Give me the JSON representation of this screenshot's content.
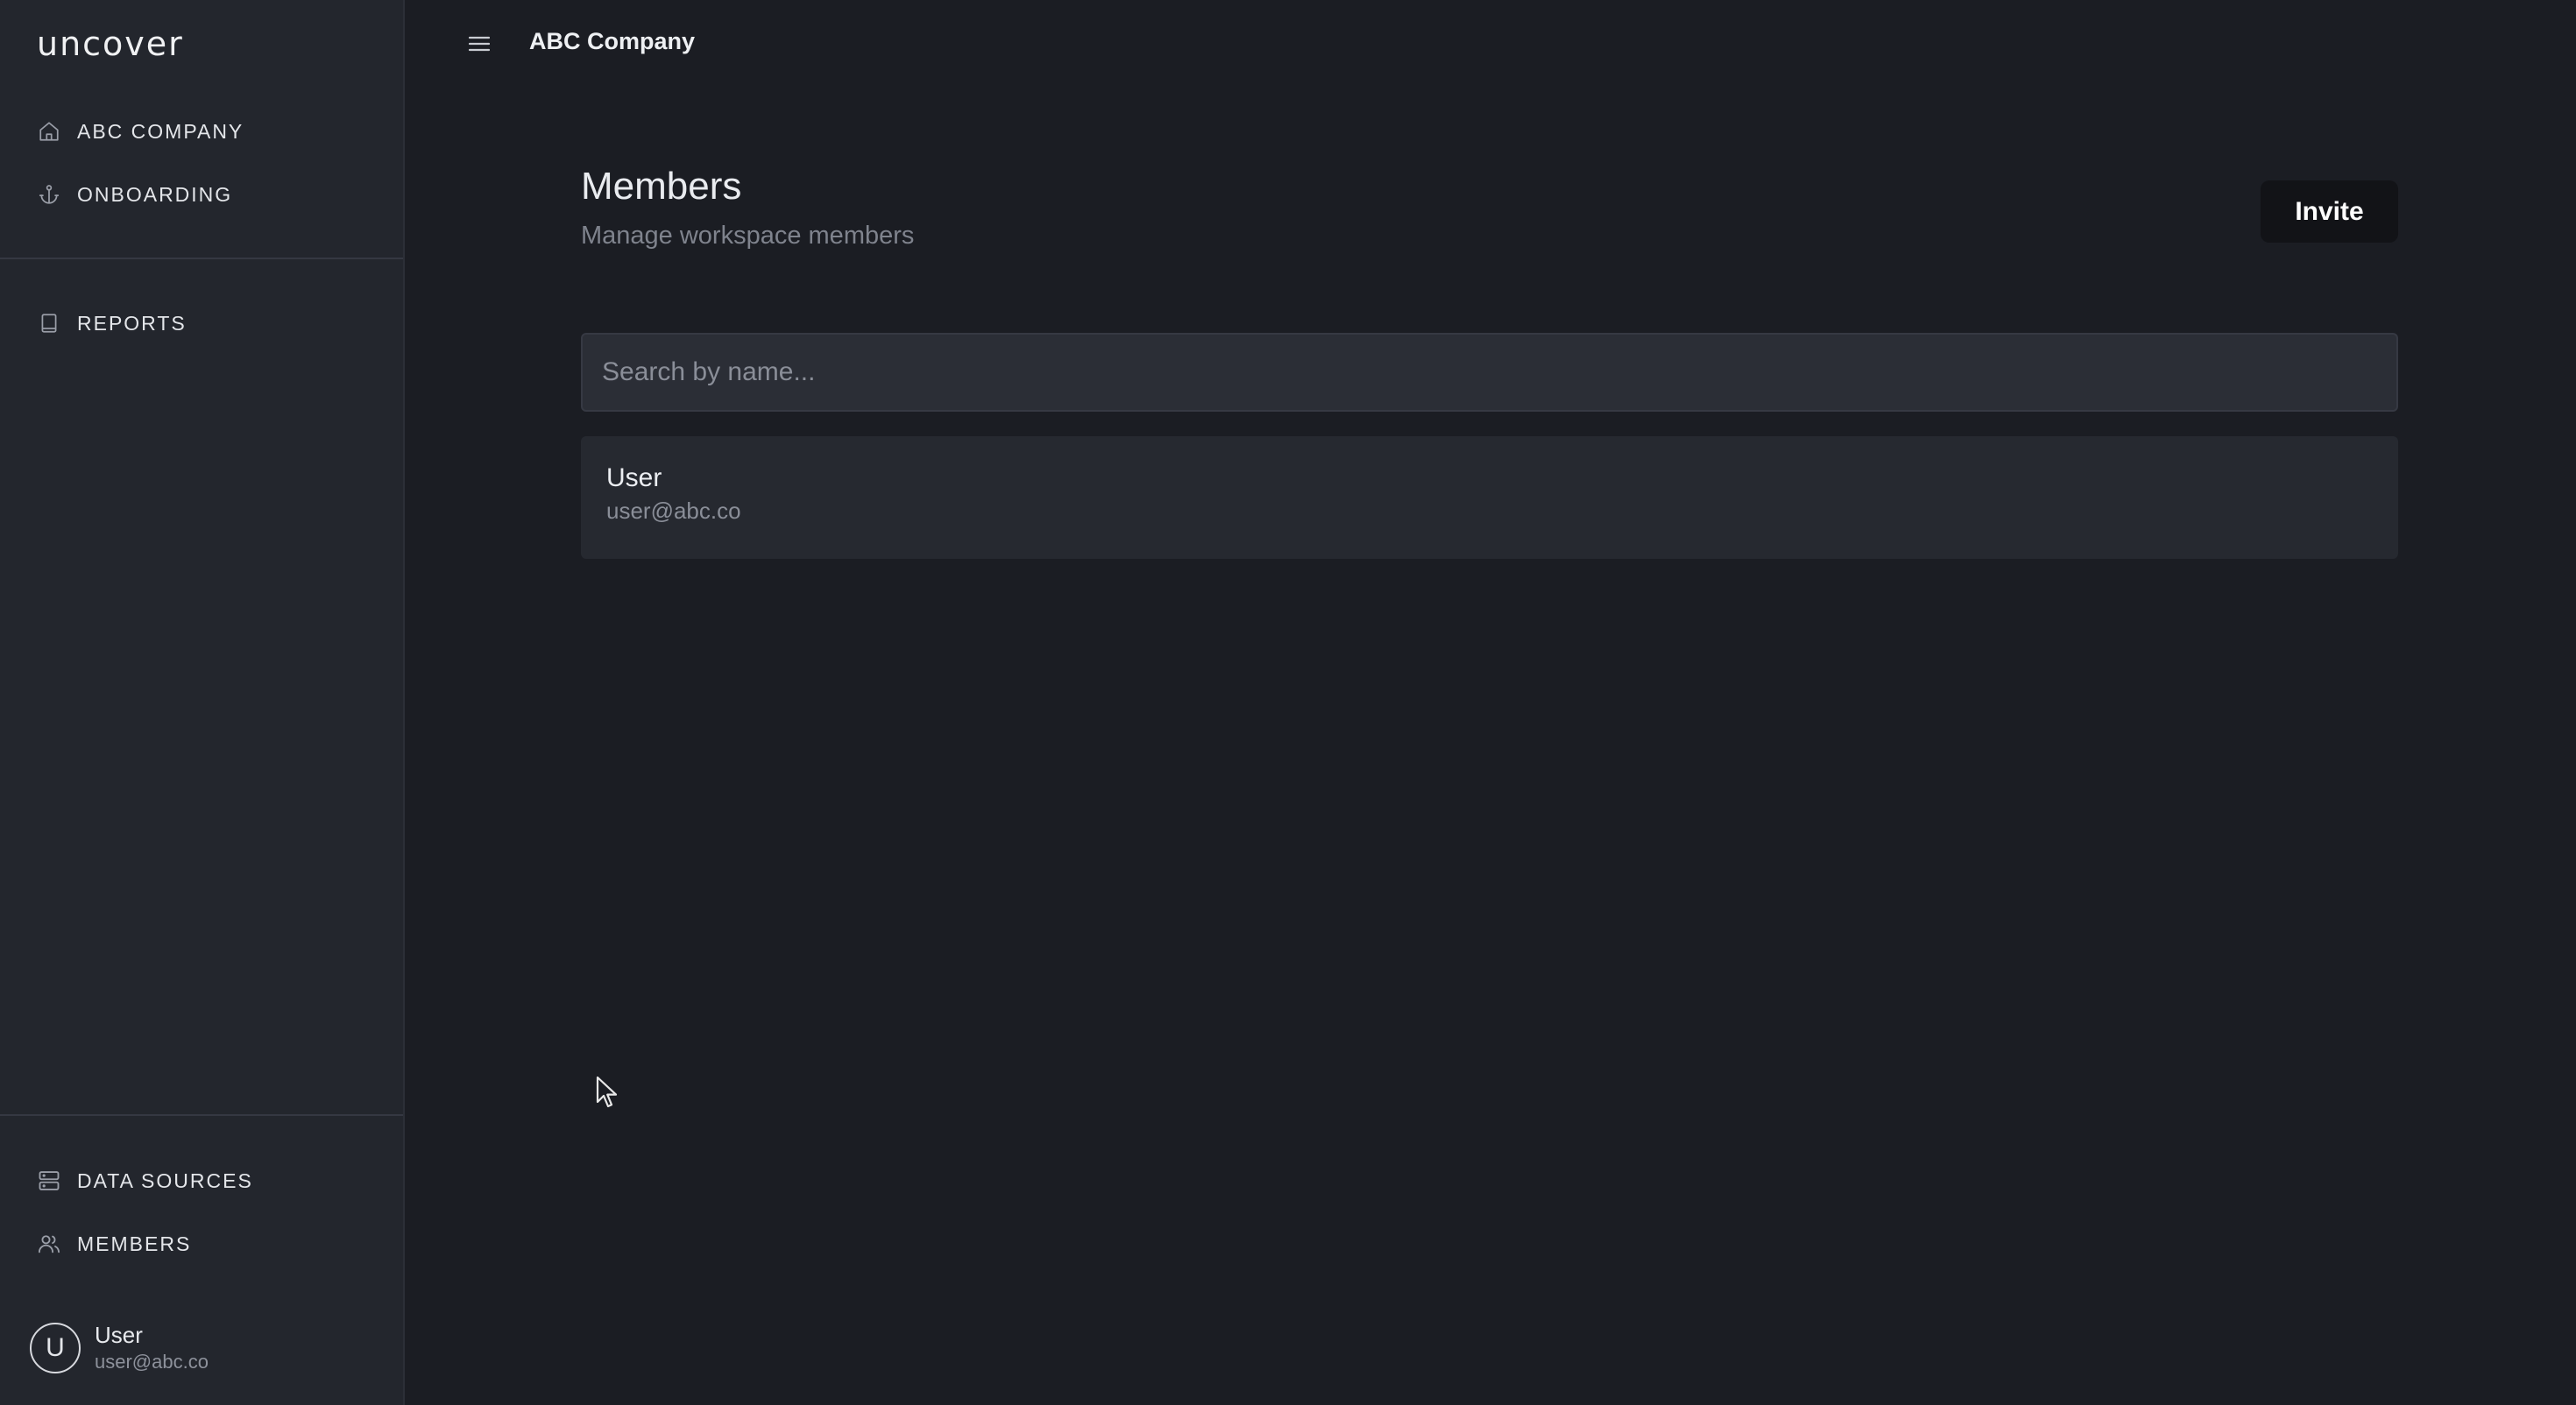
{
  "app": {
    "logo": "uncover"
  },
  "sidebar": {
    "top_items": [
      {
        "label": "ABC COMPANY",
        "icon": "home-icon"
      },
      {
        "label": "ONBOARDING",
        "icon": "anchor-icon"
      }
    ],
    "middle_items": [
      {
        "label": "REPORTS",
        "icon": "book-icon"
      }
    ],
    "bottom_items": [
      {
        "label": "DATA SOURCES",
        "icon": "server-icon"
      },
      {
        "label": "MEMBERS",
        "icon": "users-icon"
      }
    ],
    "profile": {
      "initial": "U",
      "name": "User",
      "email": "user@abc.co"
    }
  },
  "header": {
    "menu_icon": "hamburger-icon",
    "workspace": "ABC Company"
  },
  "main": {
    "title": "Members",
    "subtitle": "Manage workspace members",
    "invite_label": "Invite",
    "search": {
      "placeholder": "Search by name...",
      "value": ""
    },
    "members": [
      {
        "name": "User",
        "email": "user@abc.co"
      }
    ]
  },
  "colors": {
    "background": "#1b1d23",
    "sidebar": "#23262d",
    "invite_button": "#121317",
    "row": "#262930"
  }
}
